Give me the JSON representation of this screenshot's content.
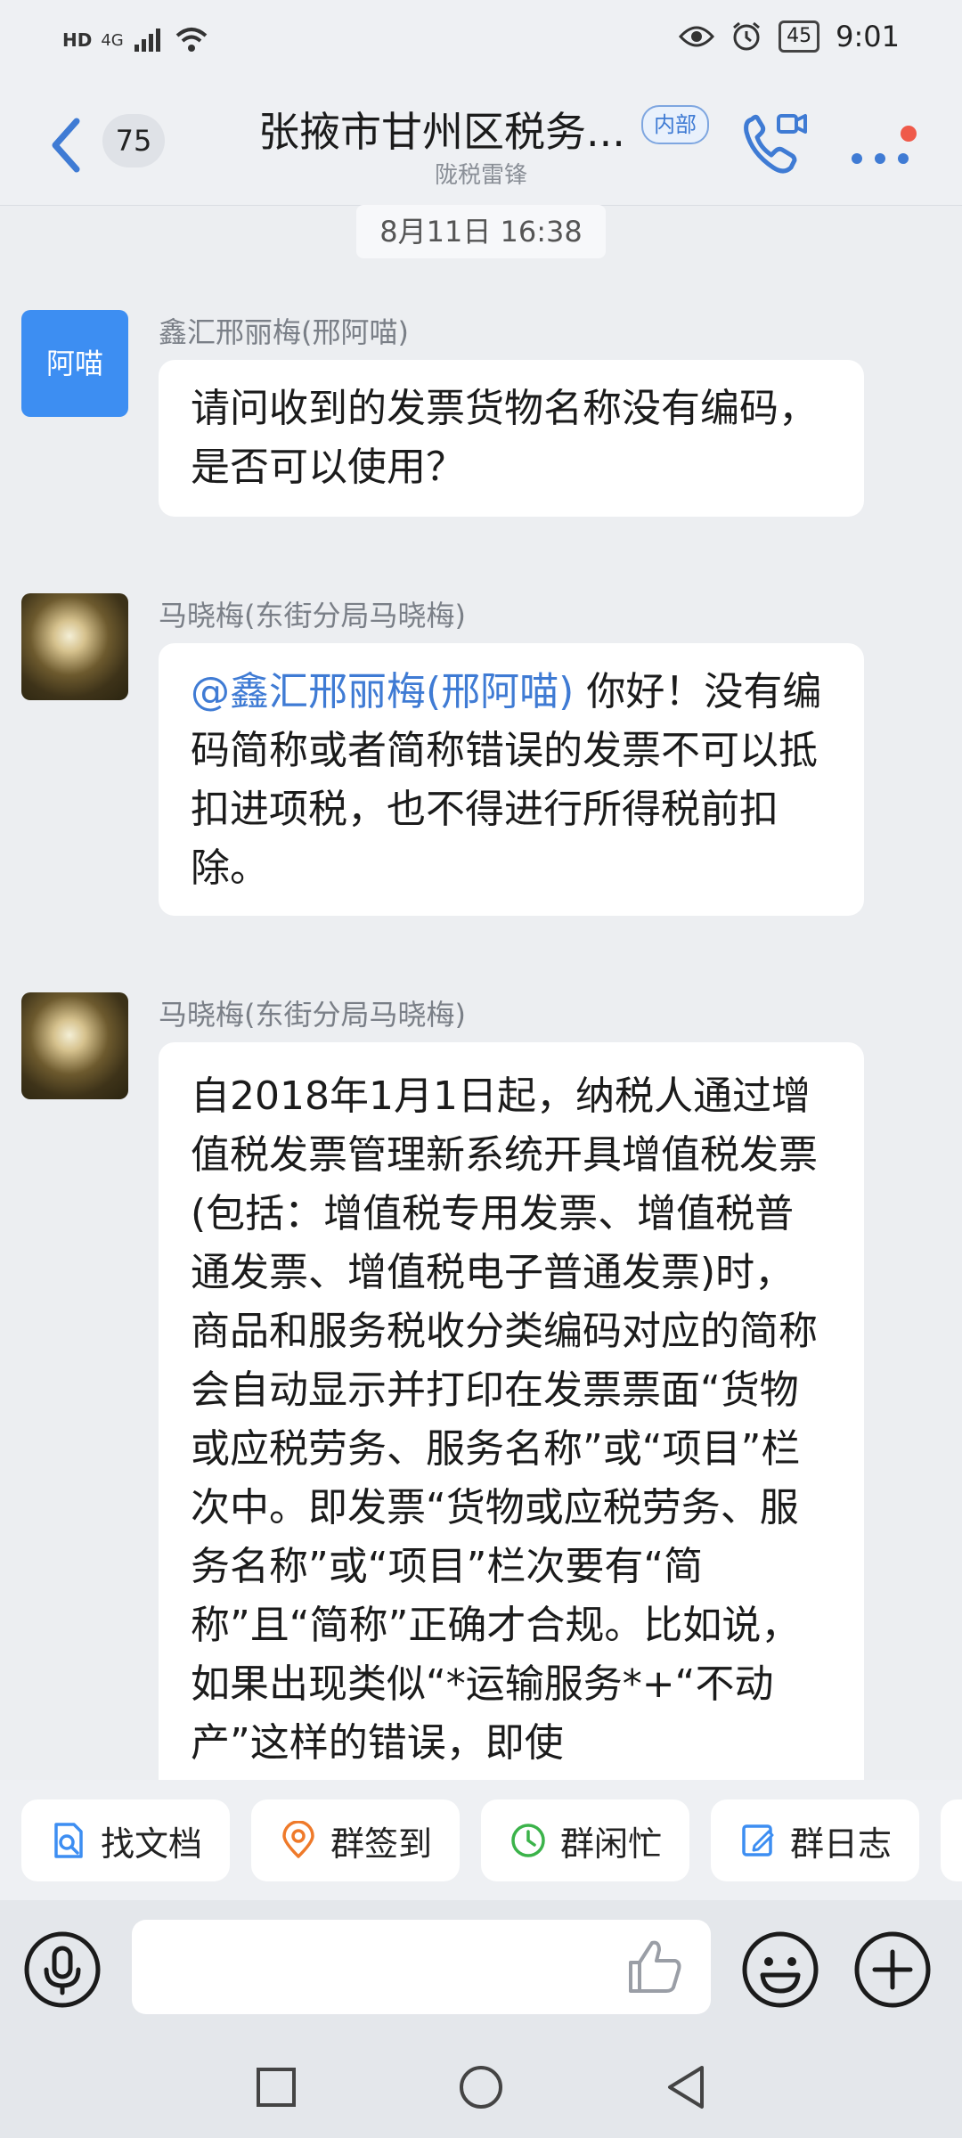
{
  "status_bar": {
    "network": "HD",
    "signal": "4G",
    "battery": "45",
    "time": "9:01"
  },
  "header": {
    "unread_count": "75",
    "title": "张掖市甘州区税务...",
    "tag": "内部",
    "subtitle": "陇税雷锋"
  },
  "timestamp": "8月11日 16:38",
  "messages": [
    {
      "avatar_text": "阿喵",
      "sender": "鑫汇邢丽梅(邢阿喵)",
      "text": "请问收到的发票货物名称没有编码，是否可以使用？"
    },
    {
      "sender": "马晓梅(东街分局马晓梅)",
      "mention": "@鑫汇邢丽梅(邢阿喵)",
      "text": " 你好！没有编码简称或者简称错误的发票不可以抵扣进项税，也不得进行所得税前扣除。"
    },
    {
      "sender": "马晓梅(东街分局马晓梅)",
      "text": "自2018年1月1日起，纳税人通过增值税发票管理新系统开具增值税发票(包括：增值税专用发票、增值税普通发票、增值税电子普通发票)时，商品和服务税收分类编码对应的简称会自动显示并打印在发票票面“货物或应税劳务、服务名称”或“项目”栏次中。即发票“货物或应税劳务、服务名称”或“项目”栏次要有“简称”且“简称”正确才合规。比如说，如果出现类似“*运输服务*+“不动产”这样的错误，即使"
    }
  ],
  "quick_actions": [
    {
      "label": "找文档",
      "icon": "doc-search-icon",
      "color": "#3d8ef2"
    },
    {
      "label": "群签到",
      "icon": "location-pin-icon",
      "color": "#ef7a2a"
    },
    {
      "label": "群闲忙",
      "icon": "clock-icon",
      "color": "#3bb34a"
    },
    {
      "label": "群日志",
      "icon": "edit-note-icon",
      "color": "#3d8ef2"
    }
  ],
  "input": {
    "placeholder": ""
  },
  "colors": {
    "accent": "#3f7bd4",
    "avatar_bg": "#3d8ef2",
    "notification_dot": "#ef5a4a"
  }
}
